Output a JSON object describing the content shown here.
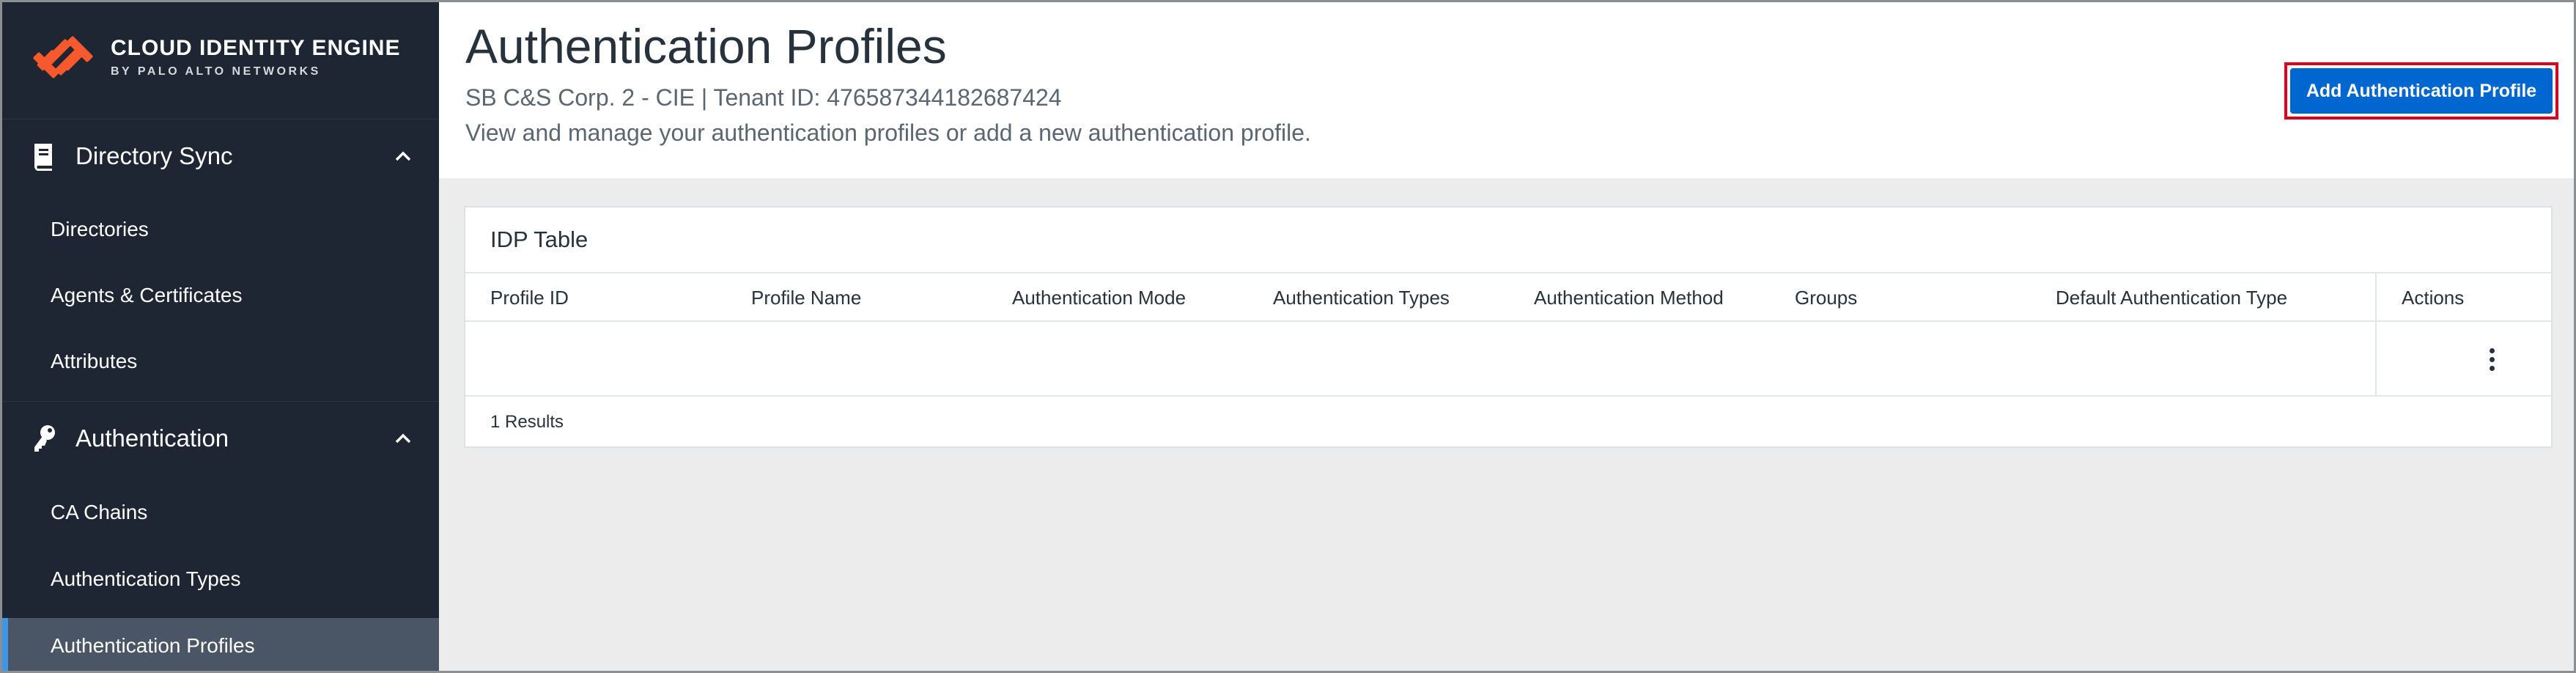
{
  "brand": {
    "title": "CLOUD IDENTITY ENGINE",
    "subtitle": "BY PALO ALTO NETWORKS",
    "accent_color": "#fa582d"
  },
  "sidebar": {
    "sections": [
      {
        "label": "Directory Sync",
        "icon": "book-icon",
        "expanded": true,
        "items": [
          {
            "label": "Directories"
          },
          {
            "label": "Agents & Certificates"
          },
          {
            "label": "Attributes"
          }
        ]
      },
      {
        "label": "Authentication",
        "icon": "key-icon",
        "expanded": true,
        "items": [
          {
            "label": "CA Chains"
          },
          {
            "label": "Authentication Types"
          },
          {
            "label": "Authentication Profiles",
            "active": true
          }
        ]
      }
    ]
  },
  "header": {
    "title": "Authentication Profiles",
    "tenant": "SB C&S Corp. 2 - CIE | Tenant ID: 476587344182687424",
    "description": "View and manage your authentication profiles or add a new authentication profile.",
    "add_button_label": "Add Authentication Profile",
    "highlight_color": "#e0001b"
  },
  "table": {
    "title": "IDP Table",
    "columns": [
      "Profile ID",
      "Profile Name",
      "Authentication Mode",
      "Authentication Types",
      "Authentication Method",
      "Groups",
      "Default Authentication Type",
      "Actions"
    ],
    "rows": [
      {
        "profile_id": "",
        "profile_name": "",
        "authentication_mode": "",
        "authentication_types": "",
        "authentication_method": "",
        "groups": "",
        "default_authentication_type": "",
        "redacted": true
      }
    ],
    "results": "1 Results"
  }
}
